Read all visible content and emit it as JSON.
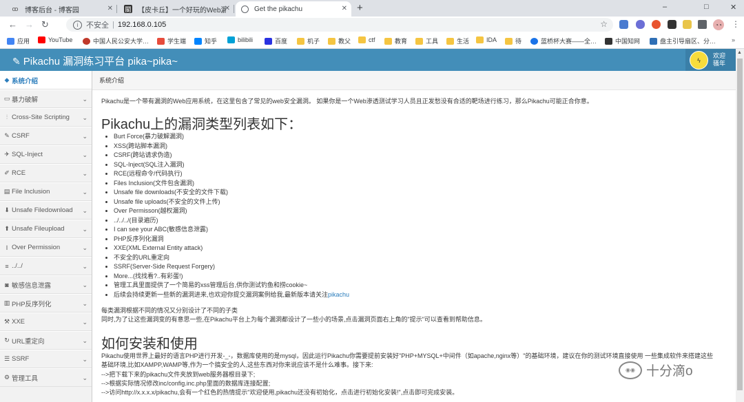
{
  "browser": {
    "tabs": [
      {
        "title": "博客后台 - 博客园",
        "icon": "cnblogs-icon"
      },
      {
        "title": "【皮卡丘】一个好玩的Web漏洞…",
        "icon": "bilibili-icon"
      },
      {
        "title": "Get the pikachu",
        "icon": "globe-icon"
      }
    ],
    "new_tab": "+",
    "window_controls": [
      "–",
      "□",
      "✕"
    ],
    "insecure_label": "不安全",
    "url": "192.168.0.105",
    "bookmarks": [
      {
        "label": "应用",
        "color": "#4285f4"
      },
      {
        "label": "YouTube",
        "color": "#ff0000"
      },
      {
        "label": "中国人民公安大学…",
        "color": "#c0392b"
      },
      {
        "label": "学生端",
        "color": "#e74c3c"
      },
      {
        "label": "知乎",
        "color": "#0084ff"
      },
      {
        "label": "bilibili",
        "color": "#00a1d6"
      },
      {
        "label": "百度",
        "color": "#2932e1"
      },
      {
        "label": "机子",
        "color": "#f5c542"
      },
      {
        "label": "教父",
        "color": "#f5c542"
      },
      {
        "label": "ctf",
        "color": "#f5c542"
      },
      {
        "label": "教育",
        "color": "#f5c542"
      },
      {
        "label": "工具",
        "color": "#f5c542"
      },
      {
        "label": "生活",
        "color": "#f5c542"
      },
      {
        "label": "IDA",
        "color": "#f5c542"
      },
      {
        "label": "待",
        "color": "#f5c542"
      },
      {
        "label": "蓝桥杯大赛——全…",
        "color": "#1a73e8"
      },
      {
        "label": "中国知网",
        "color": "#333333"
      },
      {
        "label": "盘主引导扇区、分…",
        "color": "#2f6fb5"
      }
    ]
  },
  "app": {
    "title": "Pikachu 漏洞练习平台 pika~pika~",
    "welcome": [
      "欢迎",
      "骚年"
    ],
    "header_color": "#438eb9"
  },
  "sidebar": {
    "items": [
      {
        "label": "系统介绍",
        "icon": "tag-icon",
        "active": true
      },
      {
        "label": "暴力破解",
        "icon": "desktop-icon"
      },
      {
        "label": "Cross-Site Scripting",
        "icon": "sliders-icon"
      },
      {
        "label": "CSRF",
        "icon": "pencil-icon"
      },
      {
        "label": "SQL-Inject",
        "icon": "fighter-icon"
      },
      {
        "label": "RCE",
        "icon": "pencil-icon"
      },
      {
        "label": "File Inclusion",
        "icon": "file-icon"
      },
      {
        "label": "Unsafe Filedownload",
        "icon": "download-icon"
      },
      {
        "label": "Unsafe Fileupload",
        "icon": "upload-icon"
      },
      {
        "label": "Over Permission",
        "icon": "cursor-icon"
      },
      {
        "label": "../../",
        "icon": "list-icon"
      },
      {
        "label": "敏感信息泄露",
        "icon": "camera-icon"
      },
      {
        "label": "PHP反序列化",
        "icon": "server-icon"
      },
      {
        "label": "XXE",
        "icon": "wrench-icon"
      },
      {
        "label": "URL重定向",
        "icon": "cycle-icon"
      },
      {
        "label": "SSRF",
        "icon": "stack-icon"
      },
      {
        "label": "管理工具",
        "icon": "gear-icon"
      }
    ]
  },
  "breadcrumb": "系统介绍",
  "main": {
    "intro": "Pikachu是一个带有漏洞的Web应用系统，在这里包含了常见的web安全漏洞。 如果你是一个Web渗透测试学习人员且正发愁没有合适的靶场进行练习，那么Pikachu可能正合你意。",
    "heading1": "Pikachu上的漏洞类型列表如下：",
    "vulns": [
      "Burt Force(暴力破解漏洞)",
      "XSS(跨站脚本漏洞)",
      "CSRF(跨站请求伪造)",
      "SQL-Inject(SQL注入漏洞)",
      "RCE(远程命令/代码执行)",
      "Files Inclusion(文件包含漏洞)",
      "Unsafe file downloads(不安全的文件下载)",
      "Unsafe file uploads(不安全的文件上传)",
      "Over Permisson(越权漏洞)",
      "../../../(目录遍历)",
      "I can see your ABC(敏感信息泄露)",
      "PHP反序列化漏洞",
      "XXE(XML External Entity attack)",
      "不安全的URL重定向",
      "SSRF(Server-Side Request Forgery)",
      "More...(找找看?..有彩蛋!)",
      "管理工具里面提供了一个简易的xss管理后台,供你测试钓鱼和捞cookie~"
    ],
    "vuln_last_text": "后续会持续更新一些新的漏洞进来,也欢迎你提交漏洞案例给我,最新版本请关注",
    "vuln_last_link": "pikachu",
    "para1": "每类漏洞根据不同的情况又分别设计了不同的子类",
    "para2": "同时,为了让这些漏洞变的有意思一些,在Pikachu平台上为每个漏洞都设计了一些小的场景,点击漏洞页面右上角的\"提示\"可以查看到帮助信息。",
    "heading2": "如何安装和使用",
    "install1": "Pikachu使用世界上最好的语言PHP进行开发-_-，数据库使用的是mysql，因此运行Pikachu你需要提前安装好\"PHP+MYSQL+中间件（如apache,nginx等）\"的基础环境，建议在你的测试环境直接使用 一些集成软件来搭建这些",
    "install2": "基础环境,比如XAMPP,WAMP等,作为一个搞安全的人,这些东西对你来说应该不是什么难事。接下来:",
    "install3": "-->把下载下来的pikachu文件夹放到web服务器根目录下;",
    "install4": "-->根据实际情况修改inc/config.inc.php里面的数据库连接配置;",
    "install5": "-->访问http://x.x.x.x/pikachu,会有一个红色的热情提示\"欢迎使用,pikachu还没有初始化，点击进行初始化安装!\",点击即可完成安装。"
  },
  "watermark": "十分滴o"
}
